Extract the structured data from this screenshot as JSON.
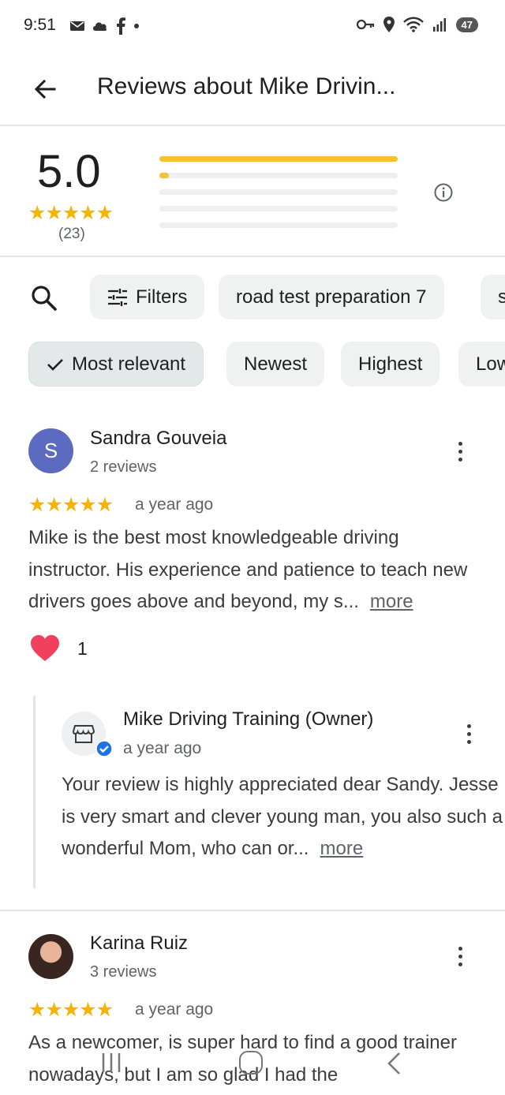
{
  "status_bar": {
    "time": "9:51",
    "left_icons": [
      "mail-icon",
      "cloud-icon",
      "facebook-icon",
      "dot-icon"
    ],
    "right_icons": [
      "key-icon",
      "location-icon",
      "wifi-icon",
      "signal-icon"
    ],
    "battery": "47"
  },
  "appbar": {
    "title": "Reviews about Mike Drivin..."
  },
  "summary": {
    "score": "5.0",
    "stars": "★★★★★",
    "count": "(23)",
    "distribution": [
      {
        "stars": 5,
        "fraction": 1.0
      },
      {
        "stars": 4,
        "fraction": 0.04
      },
      {
        "stars": 3,
        "fraction": 0.0
      },
      {
        "stars": 2,
        "fraction": 0.0
      },
      {
        "stars": 1,
        "fraction": 0.0
      }
    ]
  },
  "filters": {
    "filters_label": "Filters",
    "topic_chip": "road test preparation 7",
    "next_chip_partial": "s"
  },
  "sort": {
    "options": [
      "Most relevant",
      "Newest",
      "Highest",
      "Low"
    ],
    "selected": "Most relevant"
  },
  "reviews": [
    {
      "name": "Sandra Gouveia",
      "avatar_letter": "S",
      "avatar_color": "#5c6bc0",
      "meta": "2 reviews",
      "stars": "★★★★★",
      "when": "a year ago",
      "text": "Mike is the best most knowledgeable driving instructor. His experience and patience to teach new drivers goes above and beyond, my s...",
      "more": "more",
      "reaction_count": "1",
      "owner_reply": {
        "name": "Mike Driving Training (Owner)",
        "when": "a year ago",
        "text": "Your review is highly appreciated dear Sandy. Jesse is very smart and clever young man, you also such a wonderful Mom, who can or...",
        "more": "more"
      }
    },
    {
      "name": "Karina Ruiz",
      "meta": "3 reviews",
      "stars": "★★★★★",
      "when": "a year ago",
      "text": "As a newcomer, is super hard to find a good trainer nowadays, but I am so glad I had the"
    }
  ],
  "colors": {
    "star": "#f6b400",
    "bar_fill": "#f6c132",
    "chip_bg": "#f0f1f1",
    "heart": "#f0405e",
    "verified": "#1a73e8"
  }
}
